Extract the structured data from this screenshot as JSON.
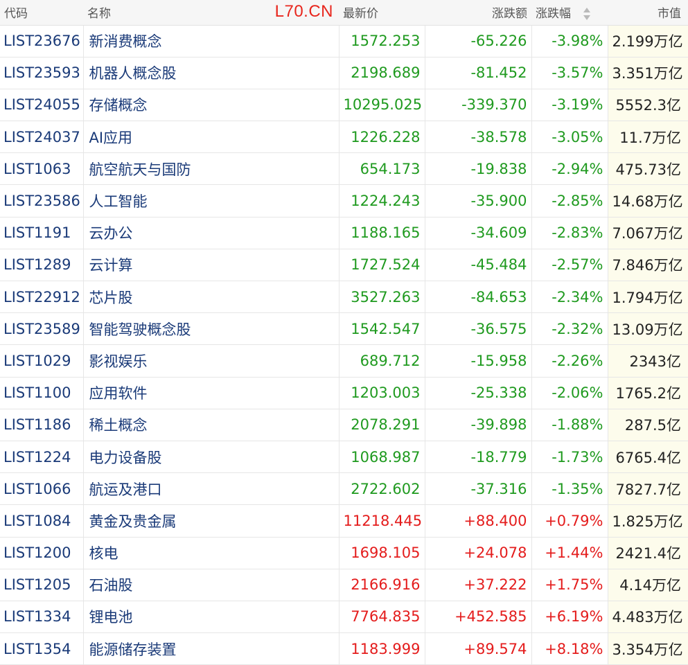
{
  "watermark": "L70.CN",
  "colors": {
    "down": "#1f9a1f",
    "up": "#e41c1c",
    "code": "#1a3a78",
    "cap_bg": "#fdfcec"
  },
  "headers": {
    "code": "代码",
    "name": "名称",
    "price": "最新价",
    "change": "涨跌额",
    "change_pct": "涨跌幅",
    "market_cap": "市值"
  },
  "sort_icon": "sort-updown-icon",
  "rows": [
    {
      "code": "LIST23676",
      "name": "新消费概念",
      "price": "1572.253",
      "change": "-65.226",
      "pct": "-3.98%",
      "cap": "2.199万亿",
      "dir": "down"
    },
    {
      "code": "LIST23593",
      "name": "机器人概念股",
      "price": "2198.689",
      "change": "-81.452",
      "pct": "-3.57%",
      "cap": "3.351万亿",
      "dir": "down"
    },
    {
      "code": "LIST24055",
      "name": "存储概念",
      "price": "10295.025",
      "change": "-339.370",
      "pct": "-3.19%",
      "cap": "5552.3亿",
      "dir": "down"
    },
    {
      "code": "LIST24037",
      "name": "AI应用",
      "price": "1226.228",
      "change": "-38.578",
      "pct": "-3.05%",
      "cap": "11.7万亿",
      "dir": "down"
    },
    {
      "code": "LIST1063",
      "name": "航空航天与国防",
      "price": "654.173",
      "change": "-19.838",
      "pct": "-2.94%",
      "cap": "475.73亿",
      "dir": "down"
    },
    {
      "code": "LIST23586",
      "name": "人工智能",
      "price": "1224.243",
      "change": "-35.900",
      "pct": "-2.85%",
      "cap": "14.68万亿",
      "dir": "down"
    },
    {
      "code": "LIST1191",
      "name": "云办公",
      "price": "1188.165",
      "change": "-34.609",
      "pct": "-2.83%",
      "cap": "7.067万亿",
      "dir": "down"
    },
    {
      "code": "LIST1289",
      "name": "云计算",
      "price": "1727.524",
      "change": "-45.484",
      "pct": "-2.57%",
      "cap": "7.846万亿",
      "dir": "down"
    },
    {
      "code": "LIST22912",
      "name": "芯片股",
      "price": "3527.263",
      "change": "-84.653",
      "pct": "-2.34%",
      "cap": "1.794万亿",
      "dir": "down"
    },
    {
      "code": "LIST23589",
      "name": "智能驾驶概念股",
      "price": "1542.547",
      "change": "-36.575",
      "pct": "-2.32%",
      "cap": "13.09万亿",
      "dir": "down"
    },
    {
      "code": "LIST1029",
      "name": "影视娱乐",
      "price": "689.712",
      "change": "-15.958",
      "pct": "-2.26%",
      "cap": "2343亿",
      "dir": "down"
    },
    {
      "code": "LIST1100",
      "name": "应用软件",
      "price": "1203.003",
      "change": "-25.338",
      "pct": "-2.06%",
      "cap": "1765.2亿",
      "dir": "down"
    },
    {
      "code": "LIST1186",
      "name": "稀土概念",
      "price": "2078.291",
      "change": "-39.898",
      "pct": "-1.88%",
      "cap": "287.5亿",
      "dir": "down"
    },
    {
      "code": "LIST1224",
      "name": "电力设备股",
      "price": "1068.987",
      "change": "-18.779",
      "pct": "-1.73%",
      "cap": "6765.4亿",
      "dir": "down"
    },
    {
      "code": "LIST1066",
      "name": "航运及港口",
      "price": "2722.602",
      "change": "-37.316",
      "pct": "-1.35%",
      "cap": "7827.7亿",
      "dir": "down"
    },
    {
      "code": "LIST1084",
      "name": "黄金及贵金属",
      "price": "11218.445",
      "change": "+88.400",
      "pct": "+0.79%",
      "cap": "1.825万亿",
      "dir": "up"
    },
    {
      "code": "LIST1200",
      "name": "核电",
      "price": "1698.105",
      "change": "+24.078",
      "pct": "+1.44%",
      "cap": "2421.4亿",
      "dir": "up"
    },
    {
      "code": "LIST1205",
      "name": "石油股",
      "price": "2166.916",
      "change": "+37.222",
      "pct": "+1.75%",
      "cap": "4.14万亿",
      "dir": "up"
    },
    {
      "code": "LIST1334",
      "name": "锂电池",
      "price": "7764.835",
      "change": "+452.585",
      "pct": "+6.19%",
      "cap": "4.483万亿",
      "dir": "up"
    },
    {
      "code": "LIST1354",
      "name": "能源储存装置",
      "price": "1183.999",
      "change": "+89.574",
      "pct": "+8.18%",
      "cap": "3.354万亿",
      "dir": "up"
    }
  ]
}
